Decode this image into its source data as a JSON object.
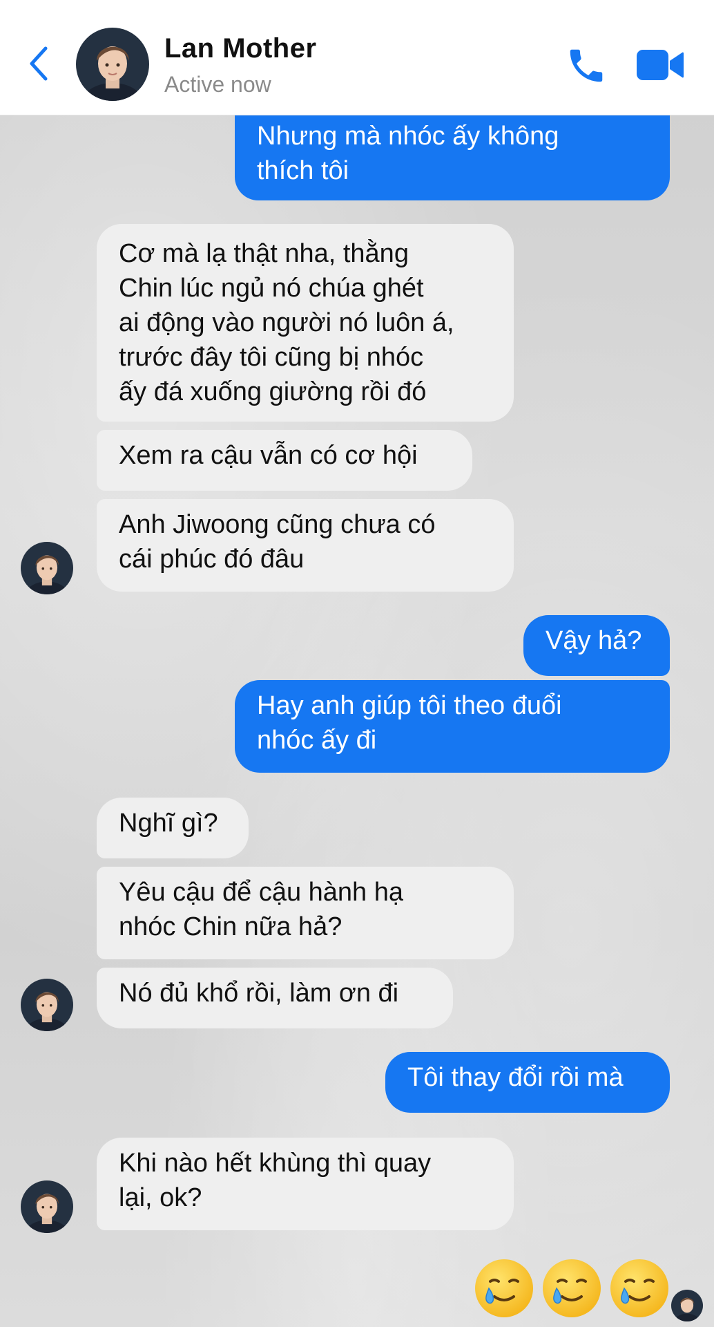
{
  "header": {
    "name": "Lan Mother",
    "status": "Active now"
  },
  "colors": {
    "accent": "#1677f2",
    "incoming_bubble": "#efefef",
    "header_bg": "#ffffff"
  },
  "icons": {
    "back": "chevron-left-icon",
    "call": "phone-icon",
    "video": "video-camera-icon",
    "reaction": "smiling-face-with-tear-emoji"
  },
  "messages": [
    {
      "from": "me",
      "text": "Nhưng mà nhóc ấy không\nthích tôi"
    },
    {
      "from": "them",
      "text": "Cơ mà lạ thật nha, thằng\nChin lúc ngủ nó chúa ghét\nai động vào người nó luôn á,\ntrước đây tôi cũng bị nhóc\nấy đá xuống giường rồi đó"
    },
    {
      "from": "them",
      "text": "Xem ra cậu vẫn có cơ hội"
    },
    {
      "from": "them",
      "text": "Anh Jiwoong cũng chưa có\ncái phúc đó đâu"
    },
    {
      "from": "me",
      "text": "Vậy hả?"
    },
    {
      "from": "me",
      "text": "Hay anh giúp tôi theo đuổi\nnhóc ấy đi"
    },
    {
      "from": "them",
      "text": "Nghĩ gì?"
    },
    {
      "from": "them",
      "text": "Yêu cậu để cậu hành hạ\nnhóc Chin nữa hả?"
    },
    {
      "from": "them",
      "text": "Nó đủ khổ rồi, làm ơn đi"
    },
    {
      "from": "me",
      "text": "Tôi thay đổi rồi mà"
    },
    {
      "from": "them",
      "text": "Khi nào hết khùng thì quay\nlại, ok?"
    }
  ],
  "reactions_sent": {
    "emoji": "🥲",
    "count": 3
  }
}
